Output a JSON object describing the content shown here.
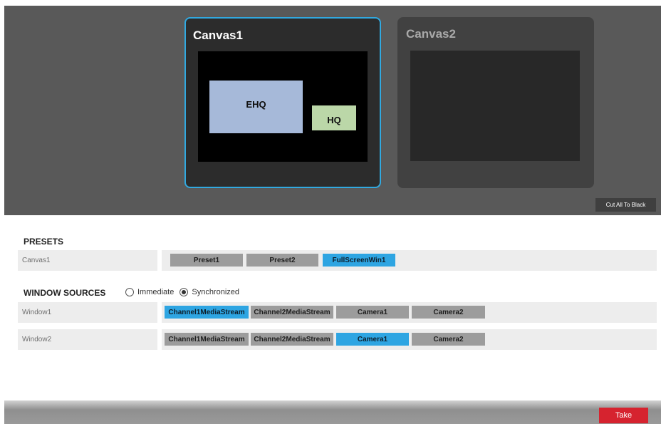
{
  "canvases": [
    {
      "title": "Canvas1",
      "windows": [
        "EHQ",
        "HQ"
      ]
    },
    {
      "title": "Canvas2",
      "windows": []
    }
  ],
  "cut_all_label": "Cut All To Black",
  "presets": {
    "title": "PRESETS",
    "row_label": "Canvas1",
    "items": [
      "Preset1",
      "Preset2",
      "FullScreenWin1"
    ],
    "selected": "FullScreenWin1"
  },
  "window_sources": {
    "title": "WINDOW SOURCES",
    "mode_options": [
      "Immediate",
      "Synchronized"
    ],
    "mode_selected": "Synchronized",
    "rows": [
      {
        "label": "Window1",
        "sources": [
          "Channel1MediaStream",
          "Channel2MediaStream",
          "Camera1",
          "Camera2"
        ],
        "selected": "Channel1MediaStream"
      },
      {
        "label": "Window2",
        "sources": [
          "Channel1MediaStream",
          "Channel2MediaStream",
          "Camera1",
          "Camera2"
        ],
        "selected": "Camera1"
      }
    ]
  },
  "take_label": "Take",
  "colors": {
    "accent_blue": "#2ea5e2",
    "take_red": "#d6232f",
    "ehq_window": "#a6b9d9",
    "hq_window": "#bbd7a8"
  }
}
